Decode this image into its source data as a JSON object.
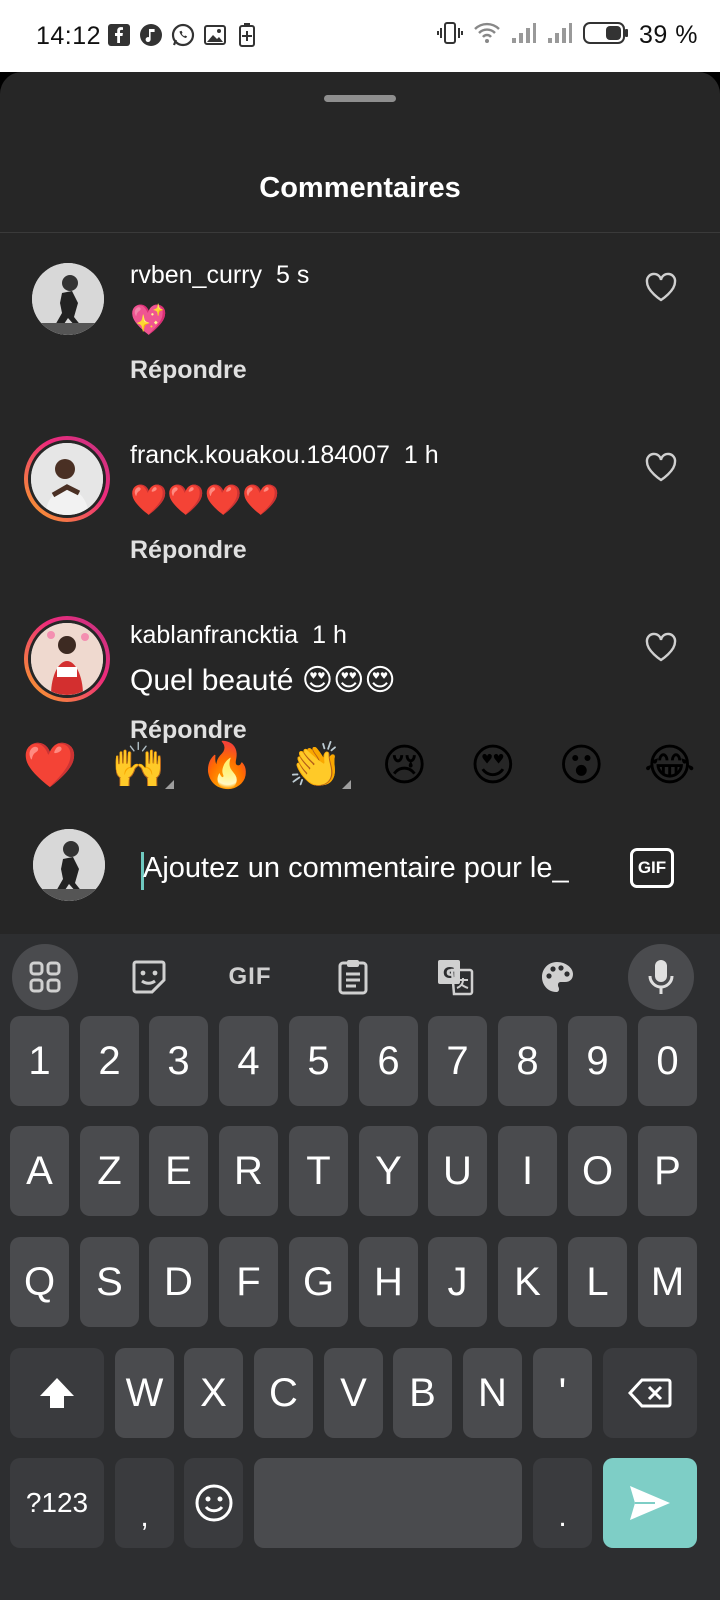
{
  "status_bar": {
    "time": "14:12",
    "battery_text": "39 %",
    "left_icons": [
      "facebook-icon",
      "music-icon",
      "whatsapp-icon",
      "gallery-icon",
      "battery-saver-icon"
    ],
    "right_icons": [
      "vibrate-icon",
      "wifi-icon",
      "signal-icon",
      "signal-icon",
      "battery-icon"
    ]
  },
  "sheet": {
    "title": "Commentaires"
  },
  "comments": [
    {
      "username": "rvben_curry",
      "time": "5 s",
      "text": "💖",
      "reply": "Répondre"
    },
    {
      "username": "franck.kouakou.184007",
      "time": "1 h",
      "text": "❤️❤️❤️❤️",
      "reply": "Répondre"
    },
    {
      "username": "kablanfrancktia",
      "time": "1 h",
      "text": "Quel beauté 😍😍😍",
      "reply": "Répondre"
    }
  ],
  "reactions": [
    "❤️",
    "🙌",
    "🔥",
    "👏",
    "😢",
    "😍",
    "😮",
    "😂"
  ],
  "composer": {
    "placeholder": "Ajoutez un commentaire pour le_",
    "gif_label": "GIF"
  },
  "keyboard": {
    "toolbar": [
      "apps-grid-icon",
      "sticker-icon",
      "GIF",
      "clipboard-icon",
      "translate-icon",
      "palette-icon",
      "mic-icon"
    ],
    "toolbar_gif": "GIF",
    "row_numbers": [
      "1",
      "2",
      "3",
      "4",
      "5",
      "6",
      "7",
      "8",
      "9",
      "0"
    ],
    "row1": [
      "A",
      "Z",
      "E",
      "R",
      "T",
      "Y",
      "U",
      "I",
      "O",
      "P"
    ],
    "row2": [
      "Q",
      "S",
      "D",
      "F",
      "G",
      "H",
      "J",
      "K",
      "L",
      "M"
    ],
    "row3": [
      "W",
      "X",
      "C",
      "V",
      "B",
      "N",
      "'"
    ],
    "symbols_label": "?123",
    "comma_label": ",",
    "period_label": "."
  },
  "colors": {
    "sheet_bg": "#262626",
    "keyboard_bg": "#2d2e30",
    "key_bg": "#4a4b4e",
    "send_key": "#7ecec6"
  }
}
